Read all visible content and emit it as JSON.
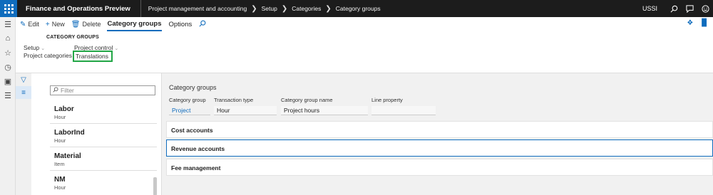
{
  "topbar": {
    "app_title": "Finance and Operations Preview",
    "breadcrumbs": [
      "Project management and accounting",
      "Setup",
      "Categories",
      "Category groups"
    ],
    "company": "USSI",
    "icons": [
      "search-icon",
      "comment-icon",
      "smiley-icon"
    ]
  },
  "actions": {
    "edit": "Edit",
    "new": "New",
    "delete": "Delete",
    "tab_category_groups": "Category groups",
    "tab_options": "Options"
  },
  "ribbon": {
    "group_title": "CATEGORY GROUPS",
    "setup_label": "Setup",
    "project_control_label": "Project control",
    "project_categories": "Project categories",
    "translations": "Translations"
  },
  "filter": {
    "placeholder": "Filter"
  },
  "list": [
    {
      "name": "Labor",
      "sub": "Hour"
    },
    {
      "name": "LaborInd",
      "sub": "Hour"
    },
    {
      "name": "Material",
      "sub": "Item"
    },
    {
      "name": "NM",
      "sub": "Hour"
    }
  ],
  "detail": {
    "title": "Category groups",
    "category_group_label": "Category group",
    "category_group_value": "Project",
    "transaction_type_label": "Transaction type",
    "transaction_type_value": "Hour",
    "category_group_name_label": "Category group name",
    "category_group_name_value": "Project hours",
    "line_property_label": "Line property",
    "line_property_value": "",
    "fasttabs": [
      "Cost accounts",
      "Revenue accounts",
      "Fee management"
    ]
  },
  "colors": {
    "accent": "#0f6cbd",
    "highlight": "#21a645",
    "topbar": "#1c1c1c"
  }
}
